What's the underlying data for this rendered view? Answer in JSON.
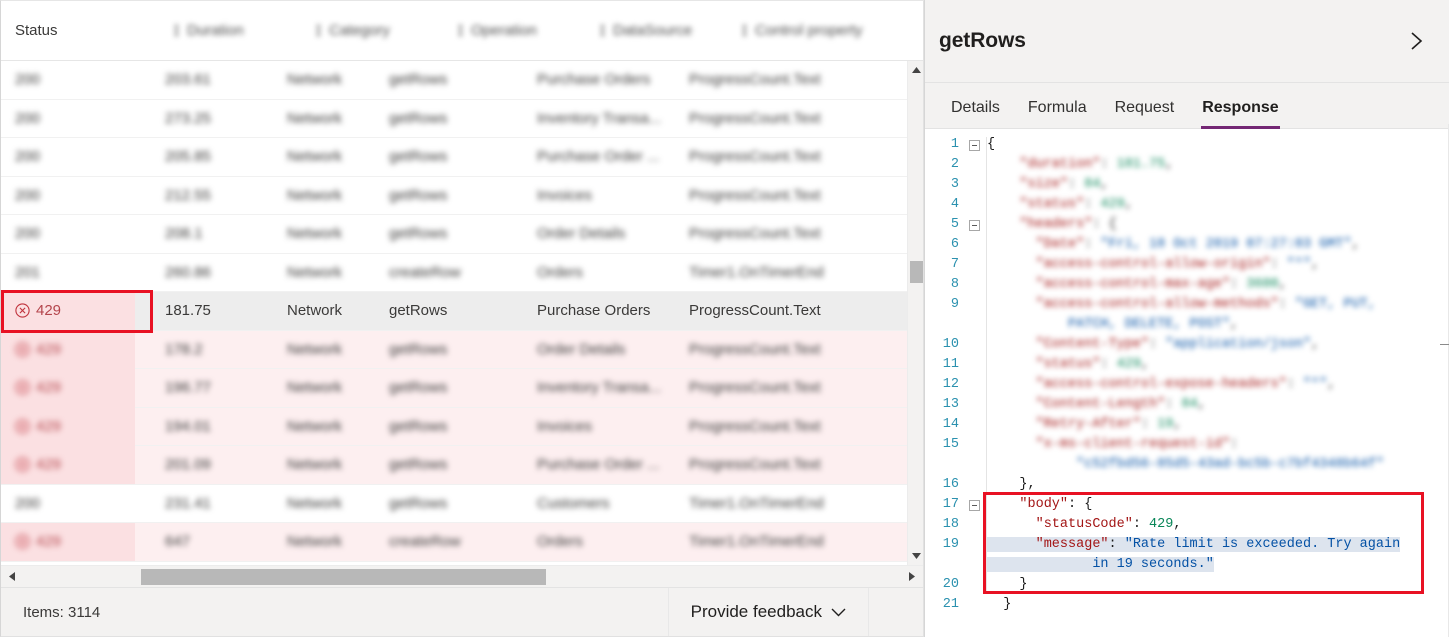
{
  "table": {
    "columns": [
      {
        "key": "status",
        "label": "Status",
        "blurred": false
      },
      {
        "key": "duration",
        "label": "Duration",
        "blurred": true
      },
      {
        "key": "category",
        "label": "Category",
        "blurred": true
      },
      {
        "key": "operation",
        "label": "Operation",
        "blurred": true
      },
      {
        "key": "datasource",
        "label": "DataSource",
        "blurred": true
      },
      {
        "key": "control",
        "label": "Control property",
        "blurred": true
      }
    ],
    "rows": [
      {
        "status": "200",
        "duration": "203.61",
        "category": "Network",
        "operation": "getRows",
        "datasource": "Purchase Orders",
        "control": "ProgressCount.Text",
        "error": false,
        "selected": false,
        "blurred": true
      },
      {
        "status": "200",
        "duration": "273.25",
        "category": "Network",
        "operation": "getRows",
        "datasource": "Inventory Transa...",
        "control": "ProgressCount.Text",
        "error": false,
        "selected": false,
        "blurred": true
      },
      {
        "status": "200",
        "duration": "205.85",
        "category": "Network",
        "operation": "getRows",
        "datasource": "Purchase Order ...",
        "control": "ProgressCount.Text",
        "error": false,
        "selected": false,
        "blurred": true
      },
      {
        "status": "200",
        "duration": "212.55",
        "category": "Network",
        "operation": "getRows",
        "datasource": "Invoices",
        "control": "ProgressCount.Text",
        "error": false,
        "selected": false,
        "blurred": true
      },
      {
        "status": "200",
        "duration": "208.1",
        "category": "Network",
        "operation": "getRows",
        "datasource": "Order Details",
        "control": "ProgressCount.Text",
        "error": false,
        "selected": false,
        "blurred": true
      },
      {
        "status": "201",
        "duration": "260.86",
        "category": "Network",
        "operation": "createRow",
        "datasource": "Orders",
        "control": "Timer1.OnTimerEnd",
        "error": false,
        "selected": false,
        "blurred": true
      },
      {
        "status": "429",
        "duration": "181.75",
        "category": "Network",
        "operation": "getRows",
        "datasource": "Purchase Orders",
        "control": "ProgressCount.Text",
        "error": true,
        "selected": true,
        "blurred": false
      },
      {
        "status": "429",
        "duration": "178.2",
        "category": "Network",
        "operation": "getRows",
        "datasource": "Order Details",
        "control": "ProgressCount.Text",
        "error": true,
        "selected": false,
        "blurred": true
      },
      {
        "status": "429",
        "duration": "196.77",
        "category": "Network",
        "operation": "getRows",
        "datasource": "Inventory Transa...",
        "control": "ProgressCount.Text",
        "error": true,
        "selected": false,
        "blurred": true
      },
      {
        "status": "429",
        "duration": "194.01",
        "category": "Network",
        "operation": "getRows",
        "datasource": "Invoices",
        "control": "ProgressCount.Text",
        "error": true,
        "selected": false,
        "blurred": true
      },
      {
        "status": "429",
        "duration": "201.09",
        "category": "Network",
        "operation": "getRows",
        "datasource": "Purchase Order ...",
        "control": "ProgressCount.Text",
        "error": true,
        "selected": false,
        "blurred": true
      },
      {
        "status": "200",
        "duration": "231.41",
        "category": "Network",
        "operation": "getRows",
        "datasource": "Customers",
        "control": "Timer1.OnTimerEnd",
        "error": false,
        "selected": false,
        "blurred": true
      },
      {
        "status": "429",
        "duration": "647",
        "category": "Network",
        "operation": "createRow",
        "datasource": "Orders",
        "control": "Timer1.OnTimerEnd",
        "error": true,
        "selected": false,
        "blurred": true
      }
    ]
  },
  "status_bar": {
    "items_label": "Items: 3114",
    "feedback_label": "Provide feedback"
  },
  "details": {
    "title": "getRows",
    "expand_icon": "chevron-right-icon",
    "tabs": [
      {
        "label": "Details",
        "active": false
      },
      {
        "label": "Formula",
        "active": false
      },
      {
        "label": "Request",
        "active": false
      },
      {
        "label": "Response",
        "active": true
      }
    ],
    "accent_color": "#742774",
    "highlight_color": "#e81123"
  },
  "response_json": {
    "lines": [
      {
        "num": "1",
        "fold": true,
        "blurred": false,
        "segments": [
          {
            "t": "{",
            "c": "p"
          }
        ]
      },
      {
        "num": "2",
        "fold": false,
        "blurred": true,
        "segments": [
          {
            "t": "    \"duration\"",
            "c": "k"
          },
          {
            "t": ": ",
            "c": "p"
          },
          {
            "t": "181.75",
            "c": "n"
          },
          {
            "t": ",",
            "c": "p"
          }
        ]
      },
      {
        "num": "3",
        "fold": false,
        "blurred": true,
        "segments": [
          {
            "t": "    \"size\"",
            "c": "k"
          },
          {
            "t": ": ",
            "c": "p"
          },
          {
            "t": "84",
            "c": "n"
          },
          {
            "t": ",",
            "c": "p"
          }
        ]
      },
      {
        "num": "4",
        "fold": false,
        "blurred": true,
        "segments": [
          {
            "t": "    \"status\"",
            "c": "k"
          },
          {
            "t": ": ",
            "c": "p"
          },
          {
            "t": "429",
            "c": "n"
          },
          {
            "t": ",",
            "c": "p"
          }
        ]
      },
      {
        "num": "5",
        "fold": true,
        "blurred": true,
        "segments": [
          {
            "t": "    \"headers\"",
            "c": "k"
          },
          {
            "t": ": {",
            "c": "p"
          }
        ]
      },
      {
        "num": "6",
        "fold": false,
        "blurred": true,
        "segments": [
          {
            "t": "      \"Date\"",
            "c": "k"
          },
          {
            "t": ": ",
            "c": "p"
          },
          {
            "t": "\"Fri, 18 Oct 2019 07:27:03 GMT\"",
            "c": "s"
          },
          {
            "t": ",",
            "c": "p"
          }
        ]
      },
      {
        "num": "7",
        "fold": false,
        "blurred": true,
        "segments": [
          {
            "t": "      \"access-control-allow-origin\"",
            "c": "k"
          },
          {
            "t": ": ",
            "c": "p"
          },
          {
            "t": "\"*\"",
            "c": "s"
          },
          {
            "t": ",",
            "c": "p"
          }
        ]
      },
      {
        "num": "8",
        "fold": false,
        "blurred": true,
        "segments": [
          {
            "t": "      \"access-control-max-age\"",
            "c": "k"
          },
          {
            "t": ": ",
            "c": "p"
          },
          {
            "t": "3600",
            "c": "n"
          },
          {
            "t": ",",
            "c": "p"
          }
        ]
      },
      {
        "num": "9",
        "fold": false,
        "blurred": true,
        "segments": [
          {
            "t": "      \"access-control-allow-methods\"",
            "c": "k"
          },
          {
            "t": ": ",
            "c": "p"
          },
          {
            "t": "\"GET, PUT,\n          PATCH, DELETE, POST\"",
            "c": "s"
          },
          {
            "t": ",",
            "c": "p"
          }
        ]
      },
      {
        "num": "10",
        "fold": false,
        "blurred": true,
        "segments": [
          {
            "t": "      \"Content-Type\"",
            "c": "k"
          },
          {
            "t": ": ",
            "c": "p"
          },
          {
            "t": "\"application/json\"",
            "c": "s"
          },
          {
            "t": ",",
            "c": "p"
          }
        ]
      },
      {
        "num": "11",
        "fold": false,
        "blurred": true,
        "segments": [
          {
            "t": "      \"status\"",
            "c": "k"
          },
          {
            "t": ": ",
            "c": "p"
          },
          {
            "t": "429",
            "c": "n"
          },
          {
            "t": ",",
            "c": "p"
          }
        ]
      },
      {
        "num": "12",
        "fold": false,
        "blurred": true,
        "segments": [
          {
            "t": "      \"access-control-expose-headers\"",
            "c": "k"
          },
          {
            "t": ": ",
            "c": "p"
          },
          {
            "t": "\"*\"",
            "c": "s"
          },
          {
            "t": ",",
            "c": "p"
          }
        ]
      },
      {
        "num": "13",
        "fold": false,
        "blurred": true,
        "segments": [
          {
            "t": "      \"Content-Length\"",
            "c": "k"
          },
          {
            "t": ": ",
            "c": "p"
          },
          {
            "t": "84",
            "c": "n"
          },
          {
            "t": ",",
            "c": "p"
          }
        ]
      },
      {
        "num": "14",
        "fold": false,
        "blurred": true,
        "segments": [
          {
            "t": "      \"Retry-After\"",
            "c": "k"
          },
          {
            "t": ": ",
            "c": "p"
          },
          {
            "t": "19",
            "c": "n"
          },
          {
            "t": ",",
            "c": "p"
          }
        ]
      },
      {
        "num": "15",
        "fold": false,
        "blurred": true,
        "segments": [
          {
            "t": "      \"x-ms-client-request-id\"",
            "c": "k"
          },
          {
            "t": ":\n           ",
            "c": "p"
          },
          {
            "t": "\"c52fbd56-85d5-43ad-bc5b-c7bf4348b64f\"",
            "c": "s"
          }
        ]
      },
      {
        "num": "16",
        "fold": false,
        "blurred": false,
        "segments": [
          {
            "t": "    },",
            "c": "p"
          }
        ]
      },
      {
        "num": "17",
        "fold": true,
        "blurred": false,
        "segments": [
          {
            "t": "    \"body\"",
            "c": "k"
          },
          {
            "t": ": {",
            "c": "p"
          }
        ]
      },
      {
        "num": "18",
        "fold": false,
        "blurred": false,
        "segments": [
          {
            "t": "      \"statusCode\"",
            "c": "k"
          },
          {
            "t": ": ",
            "c": "p"
          },
          {
            "t": "429",
            "c": "n"
          },
          {
            "t": ",",
            "c": "p"
          }
        ]
      },
      {
        "num": "19",
        "fold": false,
        "blurred": false,
        "highlight": true,
        "segments": [
          {
            "t": "      \"message\"",
            "c": "k"
          },
          {
            "t": ": ",
            "c": "p"
          },
          {
            "t": "\"Rate limit is exceeded. Try again\n             in 19 seconds.\"",
            "c": "s"
          }
        ]
      },
      {
        "num": "20",
        "fold": false,
        "blurred": false,
        "segments": [
          {
            "t": "    }",
            "c": "p"
          }
        ]
      },
      {
        "num": "21",
        "fold": false,
        "blurred": false,
        "segments": [
          {
            "t": "  }",
            "c": "p"
          }
        ]
      }
    ]
  }
}
